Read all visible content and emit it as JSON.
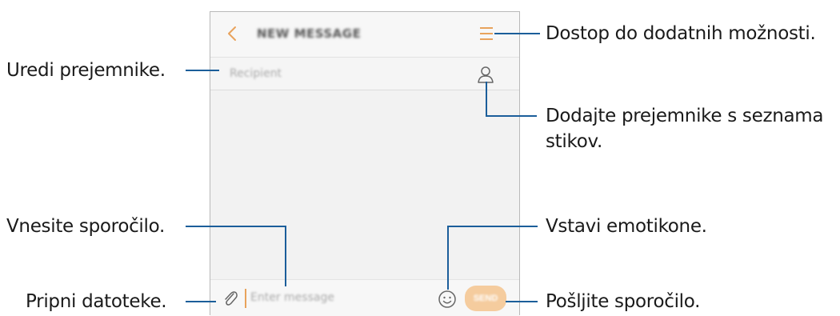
{
  "screen": {
    "title": "NEW MESSAGE",
    "recipient_placeholder": "Recipient",
    "message_placeholder": "Enter message",
    "send_label": "SEND",
    "accent_color": "#e8a35c",
    "icons": [
      "back-icon",
      "menu-icon",
      "contact-icon",
      "attach-icon",
      "emoji-icon"
    ]
  },
  "callouts": {
    "more_options": "Dostop do dodatnih možnosti.",
    "edit_recipients": "Uredi prejemnike.",
    "add_from_contacts_line1": "Dodajte prejemnike s seznama",
    "add_from_contacts_line2": "stikov.",
    "enter_message": "Vnesite sporočilo.",
    "insert_emoticons": "Vstavi emotikone.",
    "attach_files": "Pripni datoteke.",
    "send_message": "Pošljite sporočilo."
  }
}
